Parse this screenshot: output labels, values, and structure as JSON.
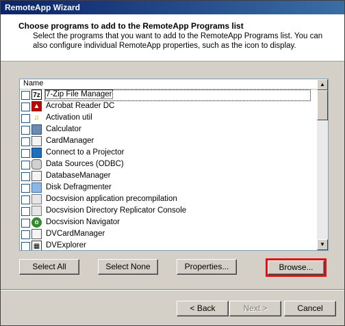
{
  "window": {
    "title": "RemoteApp Wizard"
  },
  "header": {
    "title": "Choose programs to add to the RemoteApp Programs list",
    "description": "Select the programs that you want to add to the RemoteApp Programs list. You can also configure individual RemoteApp properties, such as the icon to display."
  },
  "list": {
    "column_name": "Name",
    "items": [
      {
        "label": "7-Zip File Manager",
        "icon": "7zip-icon",
        "checked": false,
        "focused": true
      },
      {
        "label": "Acrobat Reader DC",
        "icon": "acrobat-icon",
        "checked": false
      },
      {
        "label": "Activation util",
        "icon": "activation-icon",
        "checked": false
      },
      {
        "label": "Calculator",
        "icon": "calculator-icon",
        "checked": false
      },
      {
        "label": "CardManager",
        "icon": "cardmanager-icon",
        "checked": false
      },
      {
        "label": "Connect to a Projector",
        "icon": "projector-icon",
        "checked": false
      },
      {
        "label": "Data Sources (ODBC)",
        "icon": "odbc-icon",
        "checked": false
      },
      {
        "label": "DatabaseManager",
        "icon": "databasemanager-icon",
        "checked": false
      },
      {
        "label": "Disk Defragmenter",
        "icon": "defrag-icon",
        "checked": false
      },
      {
        "label": "Docsvision application precompilation",
        "icon": "docsvision-app-icon",
        "checked": false
      },
      {
        "label": "Docsvision Directory Replicator Console",
        "icon": "docsvision-replicator-icon",
        "checked": false
      },
      {
        "label": "Docsvision Navigator",
        "icon": "docsvision-navigator-icon",
        "checked": false
      },
      {
        "label": "DVCardManager",
        "icon": "dvcardmanager-icon",
        "checked": false
      },
      {
        "label": "DVExplorer",
        "icon": "dvexplorer-icon",
        "checked": false
      }
    ]
  },
  "buttons": {
    "select_all": "Select All",
    "select_none": "Select None",
    "properties": "Properties...",
    "browse": "Browse...",
    "back": "< Back",
    "next": "Next >",
    "cancel": "Cancel"
  },
  "colors": {
    "highlight_border": "#e01010",
    "titlebar": "#0a246a"
  }
}
